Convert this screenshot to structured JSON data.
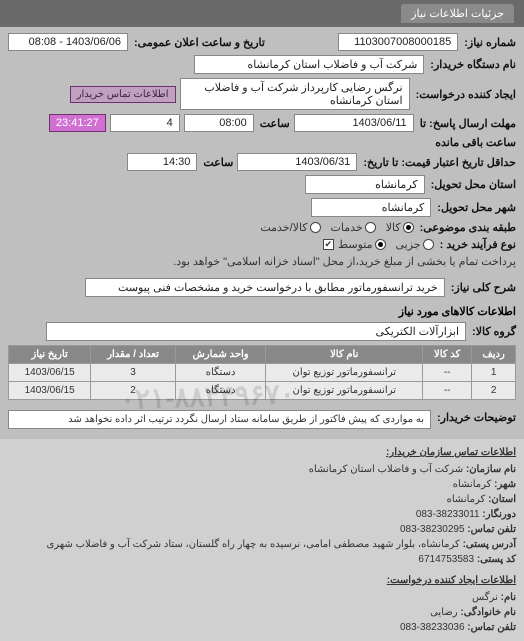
{
  "tab": {
    "title": "جزئیات اطلاعات نیاز"
  },
  "header": {
    "reqNo_label": "شماره نیاز:",
    "reqNo": "1103007008000185",
    "announceDate_label": "تاریخ و ساعت اعلان عمومی:",
    "announceDate": "1403/06/06 - 08:08",
    "buyerOrg_label": "نام دستگاه خریدار:",
    "buyerOrg": "شرکت آب و فاضلاب استان کرمانشاه",
    "creator_label": "ایجاد کننده درخواست:",
    "creator": "نرگس رضایی کارپرداز شرکت آب و فاضلاب استان کرمانشاه",
    "buyerContactBtn": "اطلاعات تماس خریدار",
    "deadline_label": "مهلت ارسال پاسخ: تا",
    "deadlineDate": "1403/06/11",
    "time_label": "ساعت",
    "deadlineTime": "08:00",
    "daysRemain": "4",
    "countdown": "23:41:27",
    "remain_label": "ساعت باقی مانده",
    "validity_label": "حداقل تاریخ اعتبار قیمت: تا تاریخ:",
    "validityDate": "1403/06/31",
    "validityTime": "14:30",
    "province_label": "استان محل تحویل:",
    "province": "کرمانشاه",
    "city_label": "شهر محل تحویل:",
    "city": "کرمانشاه",
    "subjectType_label": "طبقه بندی موضوعی:",
    "radio_kala": "کالا",
    "radio_khadamat": "خدمات",
    "radio_kalakhadamat": "کالا/خدمت",
    "buyProcess_label": "نوع فرآیند خرید :",
    "radio_jozi": "جزیی",
    "radio_motavaset": "متوسط",
    "buyProcess_note": "پرداخت تمام یا بخشی از مبلغ خرید،از محل \"اسناد خزانه اسلامی\" خواهد بود.",
    "checkbox_on": true
  },
  "desc": {
    "label": "شرح کلی نیاز:",
    "text": "خرید ترانسفورماتور مطابق با درخواست خرید و مشخصات فنی پیوست"
  },
  "goods": {
    "title": "اطلاعات کالاهای مورد نیاز",
    "group_label": "گروه کالا:",
    "group": "ابزارآلات الکتریکی",
    "columns": [
      "ردیف",
      "کد کالا",
      "نام کالا",
      "واحد شمارش",
      "تعداد / مقدار",
      "تاریخ نیاز"
    ],
    "rows": [
      {
        "idx": "1",
        "code": "--",
        "name": "ترانسفورماتور توزیع توان",
        "unit": "دستگاه",
        "qty": "3",
        "date": "1403/06/15"
      },
      {
        "idx": "2",
        "code": "--",
        "name": "ترانسفورماتور توزیع توان",
        "unit": "دستگاه",
        "qty": "2",
        "date": "1403/06/15"
      }
    ]
  },
  "buyerNote": {
    "label": "توضیحات خریدار:",
    "text": "به مواردی که پیش فاکتور از طریق سامانه ستاد ارسال نگردد ترتیب اثر داده نخواهد شد"
  },
  "watermark": "۰۲۱-۸۸۳۴۹۶۷۰",
  "contactBuyer": {
    "hdr": "اطلاعات تماس سازمان خریدار:",
    "org_k": "نام سازمان:",
    "org_v": "شرکت آب و فاضلاب استان کرمانشاه",
    "city_k": "شهر:",
    "city_v": "کرمانشاه",
    "prov_k": "استان:",
    "prov_v": "کرمانشاه",
    "fax_k": "دورنگار:",
    "fax_v": "38233011-083",
    "tel_k": "تلفن تماس:",
    "tel_v": "38230295-083",
    "addr_k": "آدرس پستی:",
    "addr_v": "کرمانشاه، بلوار شهید مصطفی امامی، نرسیده به چهار راه گلستان، ستاد شرکت آب و فاضلاب شهری",
    "post_k": "کد پستی:",
    "post_v": "6714753583"
  },
  "contactCreator": {
    "hdr": "اطلاعات ایجاد کننده درخواست:",
    "name_k": "نام:",
    "name_v": "نرگس",
    "lname_k": "نام خانوادگی:",
    "lname_v": "رضایی",
    "tel_k": "تلفن تماس:",
    "tel_v": "38233036-083"
  }
}
